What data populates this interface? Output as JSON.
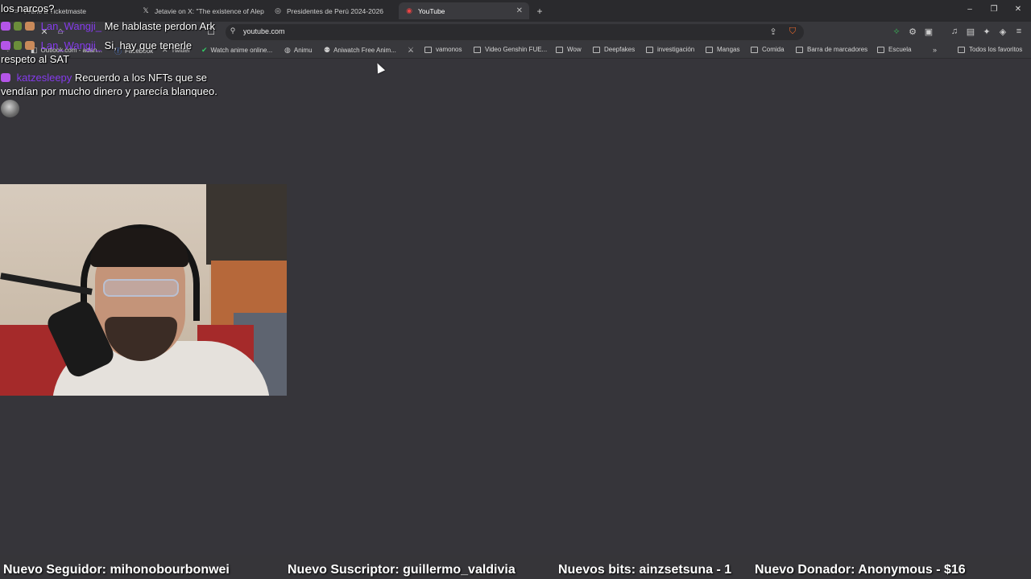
{
  "tabs": [
    {
      "label": "Freno a Ticketmaste",
      "icon": "bookmark-tab-icon"
    },
    {
      "label": "Jetavie on X: \"The existence of Aleph",
      "icon": "x-logo-icon"
    },
    {
      "label": "Presidentes de Perú 2024-2026",
      "icon": "web-page-icon"
    },
    {
      "label": "YouTube",
      "icon": "youtube-icon",
      "active": true
    }
  ],
  "address_bar": {
    "url": "youtube.com"
  },
  "bookmarks": [
    {
      "label": "Outlook.com - adan..."
    },
    {
      "label": "Facebook"
    },
    {
      "label": "Twitter"
    },
    {
      "label": "Watch anime online..."
    },
    {
      "label": "Animu"
    },
    {
      "label": "Aniwatch Free Anim..."
    },
    {
      "label": "vamonos"
    },
    {
      "label": "Video Genshin FUE..."
    },
    {
      "label": "Wow"
    },
    {
      "label": "Deepfakes"
    },
    {
      "label": "investigación"
    },
    {
      "label": "Mangas"
    },
    {
      "label": "Comida"
    },
    {
      "label": "Barra de marcadores"
    },
    {
      "label": "Escuela"
    },
    {
      "label": "Todos los favoritos"
    }
  ],
  "chat": [
    {
      "user": "",
      "text": "los narcos?"
    },
    {
      "user": "Lan_Wangji_",
      "text": "Me hablaste perdon Ark"
    },
    {
      "user": "Lan_Wangji_",
      "text": "Si, hay que tenerle",
      "text2": "respeto al SAT"
    },
    {
      "user": "katzesleepy",
      "text": "Recuerdo a los NFTs que se",
      "text2": "vendían por mucho dinero y parecía blanqueo."
    }
  ],
  "ticker": [
    {
      "label": "Nuevo Seguidor: mihonobourbonwei"
    },
    {
      "label": "Nuevo Suscriptor: guillermo_valdivia"
    },
    {
      "label": "Nuevos bits: ainzsetsuna - 1"
    },
    {
      "label": "Nuevo Donador: Anonymous - $16"
    }
  ],
  "colors": {
    "background": "#36353a",
    "chat_username": "#8d3bff",
    "chat_badge": "#b455e8"
  }
}
